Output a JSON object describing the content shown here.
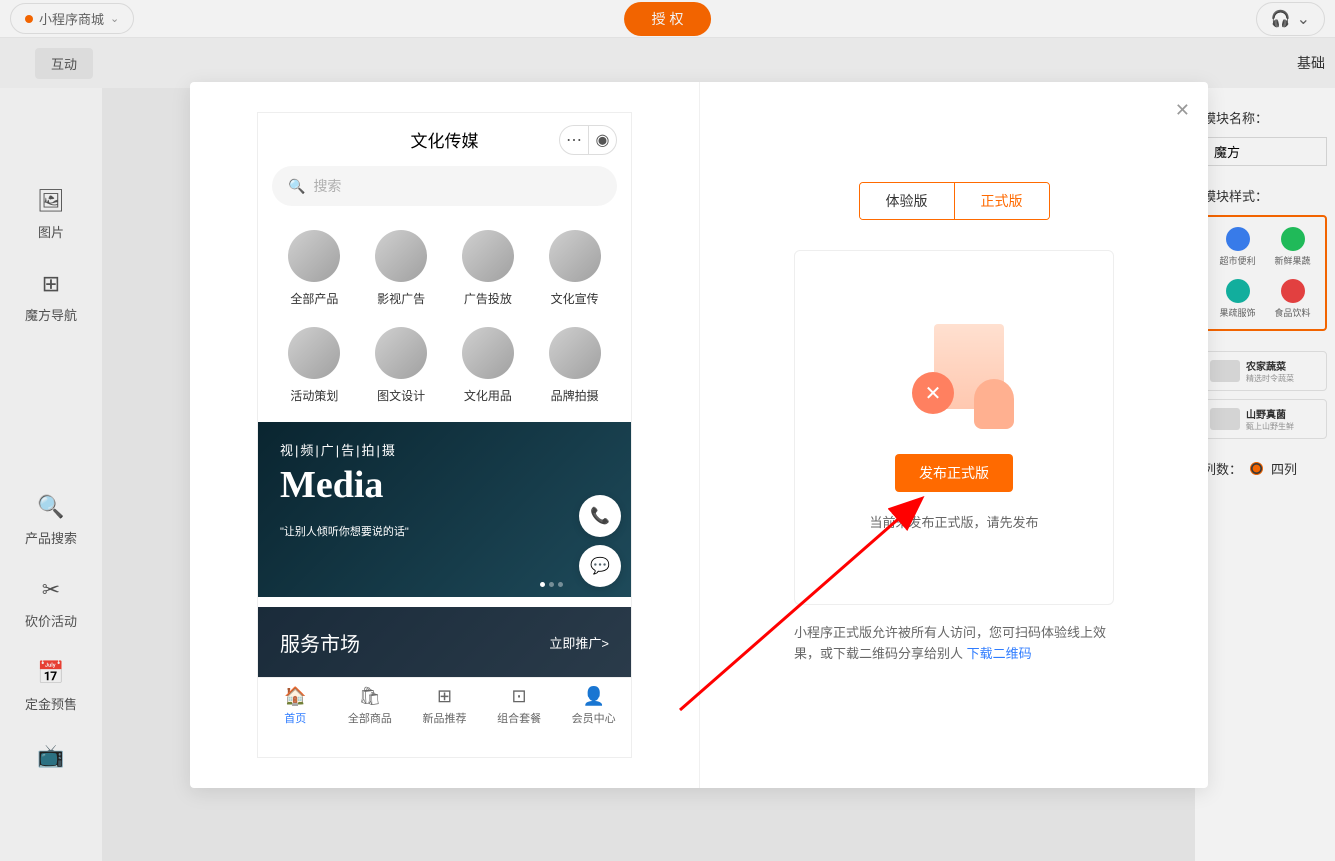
{
  "topbar": {
    "shop_name": "小程序商城",
    "auth_button": "授 权"
  },
  "subheader": {
    "pill": "互动",
    "right_label": "基础"
  },
  "sidebar": {
    "items": [
      {
        "icon": "🖼",
        "label": "图片"
      },
      {
        "icon": "⊞",
        "label": "魔方导航"
      },
      {
        "icon": "🔍",
        "label": "产品搜索"
      },
      {
        "icon": "✂",
        "label": "砍价活动"
      },
      {
        "icon": "📅",
        "label": "定金预售"
      },
      {
        "icon": "📺",
        "label": ""
      }
    ]
  },
  "right_panel": {
    "module_name_label": "模块名称：",
    "module_name_value": "魔方",
    "module_style_label": "模块样式：",
    "style_items": [
      {
        "color": "#3b82f6",
        "label": "超市便利"
      },
      {
        "color": "#22c55e",
        "label": "新鲜果蔬"
      },
      {
        "color": "#14b8a6",
        "label": "果疏服饰"
      },
      {
        "color": "#ef4444",
        "label": "食品饮料"
      }
    ],
    "presets": [
      {
        "title": "农家蔬菜",
        "sub": "精选时令蔬菜"
      },
      {
        "title": "山野真菌",
        "sub": "甄上山野生鲜"
      }
    ],
    "cols_label": "列数：",
    "cols_value": "四列"
  },
  "modal": {
    "phone": {
      "title": "文化传媒",
      "search_placeholder": "搜索",
      "categories": [
        "全部产品",
        "影视广告",
        "广告投放",
        "文化宣传",
        "活动策划",
        "图文设计",
        "文化用品",
        "品牌拍摄"
      ],
      "banner": {
        "subtitle": "视|频|广|告|拍|摄",
        "title": "Media",
        "quote": "\"让别人倾听你想要说的话\""
      },
      "market": {
        "title": "服务市场",
        "link": "立即推广>"
      },
      "tabs": [
        "首页",
        "全部商品",
        "新品推荐",
        "组合套餐",
        "会员中心"
      ]
    },
    "right": {
      "version_tabs": [
        "体验版",
        "正式版"
      ],
      "publish_button": "发布正式版",
      "hint": "当前未发布正式版，请先发布",
      "desc_prefix": "小程序正式版允许被所有人访问，您可扫码体验线上效果，或下载二维码分享给别人 ",
      "desc_link": "下载二维码"
    }
  }
}
